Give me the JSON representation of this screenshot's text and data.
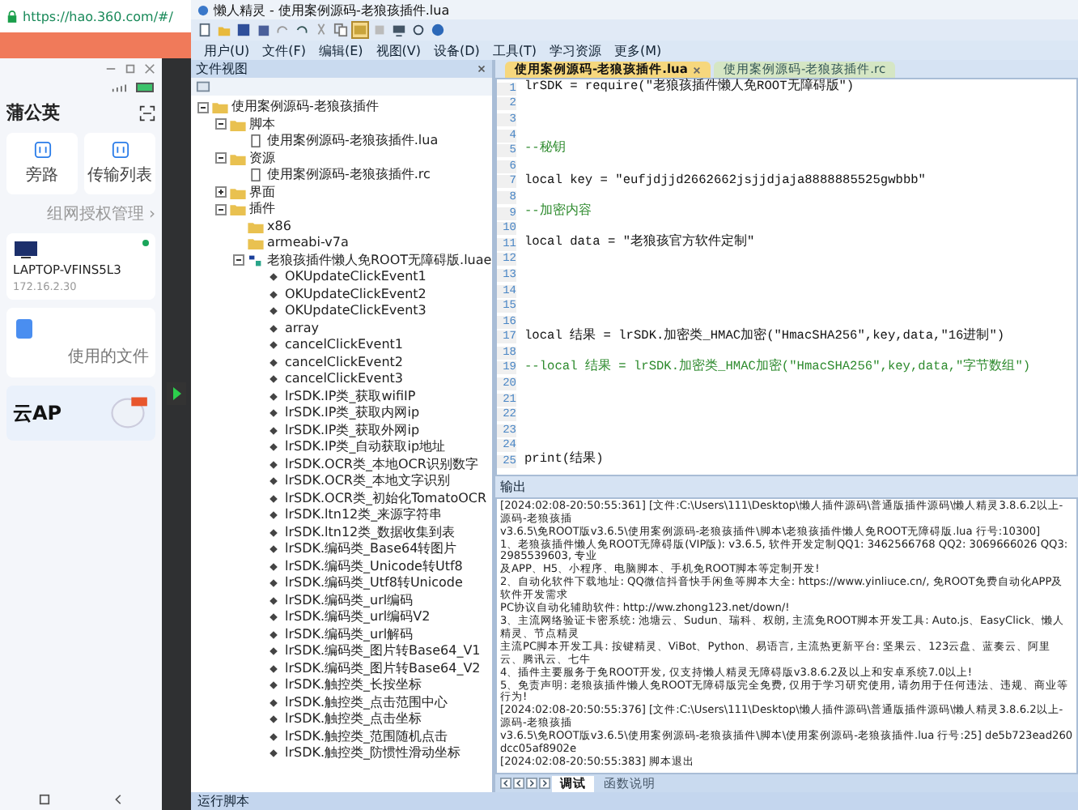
{
  "browser": {
    "url": "https://hao.360.com/#/"
  },
  "app": {
    "title": "蒲公英",
    "tiles": [
      {
        "label": "旁路"
      },
      {
        "label": "传输列表"
      }
    ],
    "link": "组网授权管理 ›",
    "device": {
      "name": "LAPTOP-VFINS5L3",
      "ip": "172.16.2.30",
      "online": true
    },
    "files_label": "使用的文件",
    "banner": {
      "title": "云AP"
    }
  },
  "ide": {
    "title": "懒人精灵 - 使用案例源码-老狼孩插件.lua",
    "menu": [
      "用户(U)",
      "文件(F)",
      "编辑(E)",
      "视图(V)",
      "设备(D)",
      "工具(T)",
      "学习资源",
      "更多(M)"
    ],
    "file_view": {
      "title": "文件视图"
    },
    "tree": [
      {
        "label": "使用案例源码-老狼孩插件",
        "kind": "folder",
        "expanded": true,
        "children": [
          {
            "label": "脚本",
            "kind": "folder",
            "expanded": true,
            "children": [
              {
                "label": "使用案例源码-老狼孩插件.lua",
                "kind": "file"
              }
            ]
          },
          {
            "label": "资源",
            "kind": "folder",
            "expanded": true,
            "children": [
              {
                "label": "使用案例源码-老狼孩插件.rc",
                "kind": "file"
              }
            ]
          },
          {
            "label": "界面",
            "kind": "folder",
            "expanded": false
          },
          {
            "label": "插件",
            "kind": "folder",
            "expanded": true,
            "children": [
              {
                "label": "x86",
                "kind": "folder"
              },
              {
                "label": "armeabi-v7a",
                "kind": "folder"
              },
              {
                "label": "老狼孩插件懒人免ROOT无障碍版.luae",
                "kind": "module",
                "expanded": true,
                "children": [
                  {
                    "label": "OKUpdateClickEvent1",
                    "kind": "function"
                  },
                  {
                    "label": "OKUpdateClickEvent2",
                    "kind": "function"
                  },
                  {
                    "label": "OKUpdateClickEvent3",
                    "kind": "function"
                  },
                  {
                    "label": "array",
                    "kind": "function"
                  },
                  {
                    "label": "cancelClickEvent1",
                    "kind": "function"
                  },
                  {
                    "label": "cancelClickEvent2",
                    "kind": "function"
                  },
                  {
                    "label": "cancelClickEvent3",
                    "kind": "function"
                  },
                  {
                    "label": "lrSDK.IP类_获取wifiIP",
                    "kind": "function"
                  },
                  {
                    "label": "lrSDK.IP类_获取内网ip",
                    "kind": "function"
                  },
                  {
                    "label": "lrSDK.IP类_获取外网ip",
                    "kind": "function"
                  },
                  {
                    "label": "lrSDK.IP类_自动获取ip地址",
                    "kind": "function"
                  },
                  {
                    "label": "lrSDK.OCR类_本地OCR识别数字",
                    "kind": "function"
                  },
                  {
                    "label": "lrSDK.OCR类_本地文字识别",
                    "kind": "function"
                  },
                  {
                    "label": "lrSDK.OCR类_初始化TomatoOCR",
                    "kind": "function"
                  },
                  {
                    "label": "lrSDK.ltn12类_来源字符串",
                    "kind": "function"
                  },
                  {
                    "label": "lrSDK.ltn12类_数据收集到表",
                    "kind": "function"
                  },
                  {
                    "label": "lrSDK.编码类_Base64转图片",
                    "kind": "function"
                  },
                  {
                    "label": "lrSDK.编码类_Unicode转Utf8",
                    "kind": "function"
                  },
                  {
                    "label": "lrSDK.编码类_Utf8转Unicode",
                    "kind": "function"
                  },
                  {
                    "label": "lrSDK.编码类_url编码",
                    "kind": "function"
                  },
                  {
                    "label": "lrSDK.编码类_url编码V2",
                    "kind": "function"
                  },
                  {
                    "label": "lrSDK.编码类_url解码",
                    "kind": "function"
                  },
                  {
                    "label": "lrSDK.编码类_图片转Base64_V1",
                    "kind": "function"
                  },
                  {
                    "label": "lrSDK.编码类_图片转Base64_V2",
                    "kind": "function"
                  },
                  {
                    "label": "lrSDK.触控类_长按坐标",
                    "kind": "function"
                  },
                  {
                    "label": "lrSDK.触控类_点击范围中心",
                    "kind": "function"
                  },
                  {
                    "label": "lrSDK.触控类_点击坐标",
                    "kind": "function"
                  },
                  {
                    "label": "lrSDK.触控类_范围随机点击",
                    "kind": "function"
                  },
                  {
                    "label": "lrSDK.触控类_防惯性滑动坐标",
                    "kind": "function"
                  }
                ]
              }
            ]
          }
        ]
      }
    ],
    "editor_tabs": [
      {
        "label": "使用案例源码-老狼孩插件.lua",
        "selected": true
      },
      {
        "label": "使用案例源码-老狼孩插件.rc",
        "selected": false
      }
    ],
    "code": [
      {
        "n": "1",
        "kind": "code",
        "text": "lrSDK = require(\"老狼孩插件懒人免ROOT无障碍版\")"
      },
      {
        "n": "2",
        "kind": "blank"
      },
      {
        "n": "3",
        "kind": "blank"
      },
      {
        "n": "4",
        "kind": "blank"
      },
      {
        "n": "5",
        "kind": "comment",
        "text": "--秘钥"
      },
      {
        "n": "6",
        "kind": "blank"
      },
      {
        "n": "7",
        "kind": "code",
        "text": "local key = \"eufjdjjd2662662jsjjdjaja8888885525gwbbb\""
      },
      {
        "n": "8",
        "kind": "blank"
      },
      {
        "n": "9",
        "kind": "comment",
        "text": "--加密内容"
      },
      {
        "n": "10",
        "kind": "blank"
      },
      {
        "n": "11",
        "kind": "code",
        "text": "local data = \"老狼孩官方软件定制\""
      },
      {
        "n": "12",
        "kind": "blank"
      },
      {
        "n": "13",
        "kind": "blank"
      },
      {
        "n": "14",
        "kind": "blank"
      },
      {
        "n": "15",
        "kind": "blank"
      },
      {
        "n": "16",
        "kind": "blank"
      },
      {
        "n": "17",
        "kind": "code",
        "text": "local 结果 = lrSDK.加密类_HMAC加密(\"HmacSHA256\",key,data,\"16进制\")"
      },
      {
        "n": "18",
        "kind": "blank"
      },
      {
        "n": "19",
        "kind": "comment",
        "text": "--local 结果 = lrSDK.加密类_HMAC加密(\"HmacSHA256\",key,data,\"字节数组\")"
      },
      {
        "n": "20",
        "kind": "blank"
      },
      {
        "n": "21",
        "kind": "blank"
      },
      {
        "n": "22",
        "kind": "blank"
      },
      {
        "n": "23",
        "kind": "blank"
      },
      {
        "n": "24",
        "kind": "blank"
      },
      {
        "n": "25",
        "kind": "code",
        "text": "print(结果)"
      }
    ],
    "output": {
      "title": "输出",
      "lines": [
        "[2024:02:08-20:50:55:361] [文件:C:\\Users\\111\\Desktop\\懒人插件源码\\普通版插件源码\\懒人精灵3.8.6.2以上-源码-老狼孩插",
        "v3.6.5\\免ROOT版v3.6.5\\使用案例源码-老狼孩插件\\脚本\\老狼孩插件懒人免ROOT无障碍版.lua 行号:10300]",
        "1、老狼孩插件懒人免ROOT无障碍版(VIP版): v3.6.5, 软件开发定制QQ1: 3462566768 QQ2: 3069666026 QQ3: 2985539603, 专业",
        "及APP、H5、小程序、电脑脚本、手机免ROOT脚本等定制开发!",
        "2、自动化软件下载地址: QQ微信抖音快手闲鱼等脚本大全: https://www.yinliuce.cn/, 免ROOT免费自动化APP及软件开发需求",
        "PC协议自动化辅助软件: http://ww.zhong123.net/down/!",
        "3、主流网络验证卡密系统: 池塘云、Sudun、瑞科、权朗, 主流免ROOT脚本开发工具: Auto.js、EasyClick、懒人精灵、节点精灵",
        "主流PC脚本开发工具: 按键精灵、ViBot、Python、易语言, 主流热更新平台: 坚果云、123云盘、蓝奏云、阿里云、腾讯云、七牛",
        "4、插件主要服务于免ROOT开发, 仅支持懒人精灵无障碍版v3.8.6.2及以上和安卓系统7.0以上!",
        "5、免责声明: 老狼孩插件懒人免ROOT无障碍版完全免费, 仅用于学习研究使用, 请勿用于任何违法、违规、商业等行为!",
        "[2024:02:08-20:50:55:376] [文件:C:\\Users\\111\\Desktop\\懒人插件源码\\普通版插件源码\\懒人精灵3.8.6.2以上-源码-老狼孩插",
        "v3.6.5\\免ROOT版v3.6.5\\使用案例源码-老狼孩插件\\脚本\\使用案例源码-老狼孩插件.lua 行号:25] de5b723ead260dcc05af8902e",
        "[2024:02:08-20:50:55:383] 脚本退出"
      ]
    },
    "output_tabs": [
      {
        "label": "调试",
        "selected": true
      },
      {
        "label": "函数说明",
        "selected": false
      }
    ],
    "status_bar": "运行脚本"
  }
}
